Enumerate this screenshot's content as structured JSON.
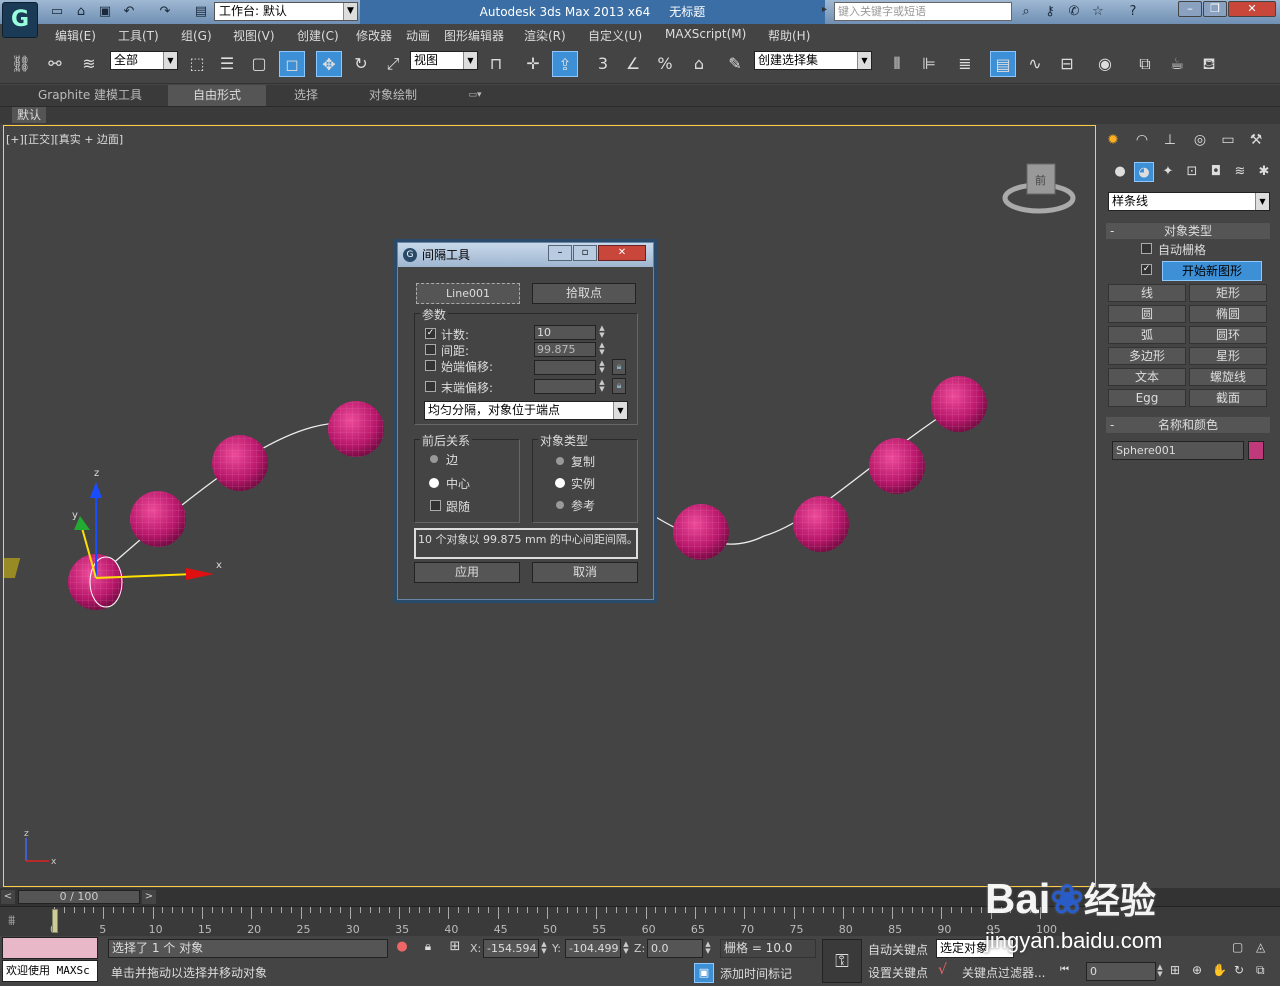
{
  "titlebar": {
    "workspace_label": "工作台: 默认",
    "app_title": "Autodesk 3ds Max  2013 x64",
    "doc_title": "无标题",
    "search_placeholder": "键入关键字或短语"
  },
  "menu": [
    "编辑(E)",
    "工具(T)",
    "组(G)",
    "视图(V)",
    "创建(C)",
    "修改器",
    "动画",
    "图形编辑器",
    "渲染(R)",
    "自定义(U)",
    "MAXScript(M)",
    "帮助(H)"
  ],
  "toolbar": {
    "filter_value": "全部",
    "refcoord_value": "视图",
    "selset_value": "创建选择集",
    "snap_label": "3",
    "angle_label": "%"
  },
  "ribbon": {
    "tabs": [
      "Graphite 建模工具",
      "自由形式",
      "选择",
      "对象绘制"
    ],
    "sub_label": "默认"
  },
  "viewport": {
    "label_bracket1": "[+]",
    "label_bracket2": "[正交]",
    "label_bracket3": "[真实 + 边面]",
    "gizmo_x": "x",
    "gizmo_y": "y",
    "gizmo_z": "z",
    "axis_x": "x",
    "axis_z": "z",
    "viewcube_label": "前"
  },
  "command_panel": {
    "category_value": "样条线",
    "object_type_header": "对象类型",
    "autogrid_label": "自动栅格",
    "start_new_shape_label": "开始新图形",
    "buttons": [
      "线",
      "矩形",
      "圆",
      "椭圆",
      "弧",
      "圆环",
      "多边形",
      "星形",
      "文本",
      "螺旋线",
      "Egg",
      "截面"
    ],
    "name_color_header": "名称和颜色",
    "object_name": "Sphere001",
    "object_color": "#c0397a"
  },
  "dialog": {
    "title": "间隔工具",
    "path_button": "Line001",
    "pick_points_button": "拾取点",
    "params_label": "参数",
    "count_label": "计数:",
    "count_value": "10",
    "spacing_label": "间距:",
    "spacing_value": "99.875",
    "start_offset_label": "始端偏移:",
    "end_offset_label": "末端偏移:",
    "distribution_value": "均匀分隔，对象位于端点",
    "context_label": "前后关系",
    "context_edge": "边",
    "context_center": "中心",
    "context_follow": "跟随",
    "objtype_label": "对象类型",
    "objtype_copy": "复制",
    "objtype_instance": "实例",
    "objtype_reference": "参考",
    "info_text": "10 个对象以 99.875 mm 的中心间距间隔。",
    "apply_button": "应用",
    "cancel_button": "取消"
  },
  "timeline": {
    "frame_display": "0 / 100",
    "ticks": [
      "0",
      "5",
      "10",
      "15",
      "20",
      "25",
      "30",
      "35",
      "40",
      "45",
      "50",
      "55",
      "60",
      "65",
      "70",
      "75",
      "80",
      "85",
      "90",
      "95",
      "100"
    ]
  },
  "status": {
    "selection_text": "选择了 1 个 对象",
    "prompt_text": "单击并拖动以选择并移动对象",
    "welcome_text": "欢迎使用 MAXSc",
    "x_label": "X:",
    "x_value": "-154.594",
    "y_label": "Y:",
    "y_value": "-104.499",
    "z_label": "Z:",
    "z_value": "0.0",
    "grid_text": "栅格 = 10.0",
    "add_time_tag": "添加时间标记",
    "auto_key": "自动关键点",
    "selected_obj": "选定对象",
    "set_key": "设置关键点",
    "key_filters": "关键点过滤器...",
    "frame_field": "0"
  },
  "watermark": {
    "brand": "Bai",
    "brand2": "经验",
    "url": "jingyan.baidu.com"
  }
}
